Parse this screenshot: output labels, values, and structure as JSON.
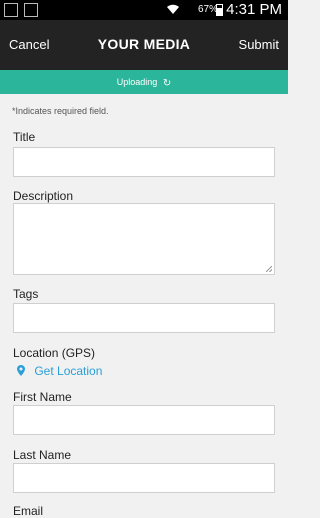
{
  "status_bar": {
    "battery_percent": "67%",
    "time": "4:31 PM",
    "icons": [
      "notification-icon",
      "image-icon",
      "wifi-icon",
      "battery-icon"
    ]
  },
  "header": {
    "cancel_label": "Cancel",
    "title": "YOUR MEDIA",
    "submit_label": "Submit"
  },
  "upload_bar": {
    "label": "Uploading",
    "icon": "refresh-icon",
    "color": "#2bb59a"
  },
  "form": {
    "required_note": "*Indicates required field.",
    "title_label": "Title",
    "title_value": "",
    "description_label": "Description",
    "description_value": "",
    "tags_label": "Tags",
    "tags_value": "",
    "location_label": "Location (GPS)",
    "get_location_label": "Get Location",
    "first_name_label": "First Name",
    "first_name_value": "",
    "last_name_label": "Last Name",
    "last_name_value": "",
    "email_label": "Email"
  },
  "colors": {
    "header_bg": "#232323",
    "accent_link": "#2a9fd8"
  }
}
